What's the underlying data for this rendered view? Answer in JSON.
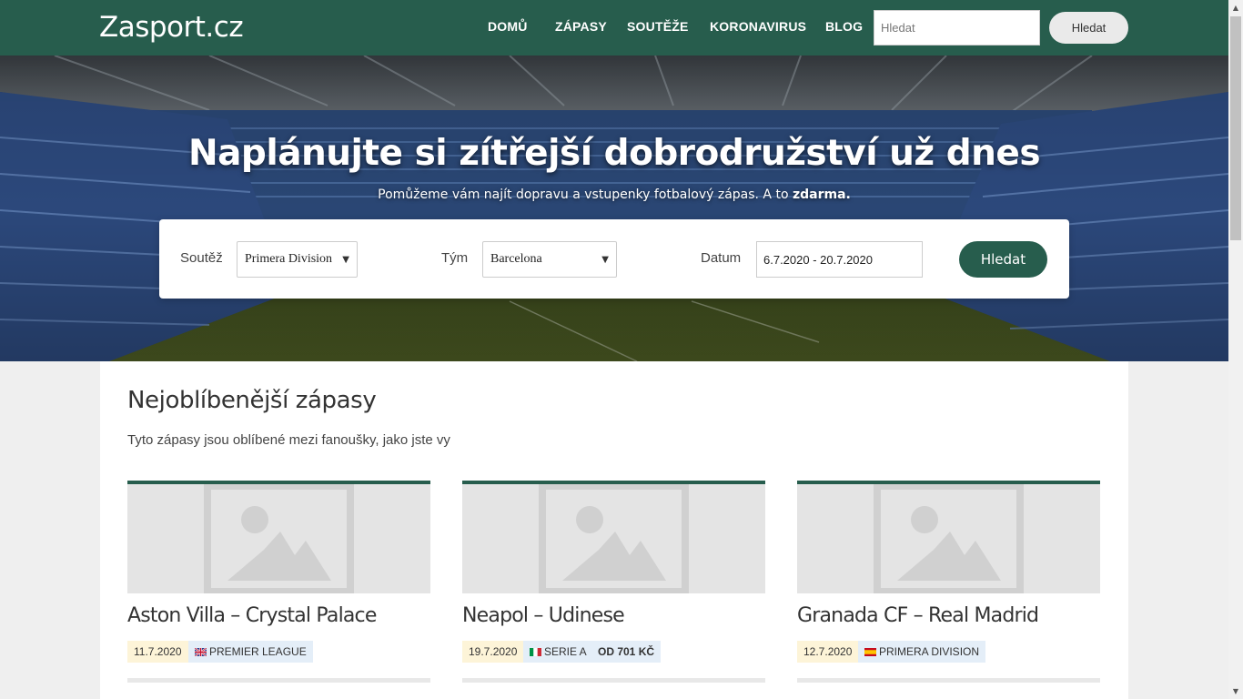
{
  "header": {
    "brand": "Zasport.cz",
    "nav": [
      {
        "label": "DOMŮ"
      },
      {
        "label": "ZÁPASY"
      },
      {
        "label": "SOUTĚŽE"
      },
      {
        "label": "KORONAVIRUS"
      },
      {
        "label": "BLOG"
      }
    ],
    "search_placeholder": "Hledat",
    "search_button": "Hledat"
  },
  "hero": {
    "title": "Naplánujte si zítřejší dobrodružství už dnes",
    "subtitle_prefix": "Pomůžeme vám najít dopravu a vstupenky fotbalový zápas. A to ",
    "subtitle_bold": "zdarma."
  },
  "search_panel": {
    "competition_label": "Soutěž",
    "competition_value": "Primera Division",
    "team_label": "Tým",
    "team_value": "Barcelona",
    "date_label": "Datum",
    "date_value": "6.7.2020 - 20.7.2020",
    "submit": "Hledat"
  },
  "popular": {
    "title": "Nejoblíbenější zápasy",
    "subtitle": "Tyto zápasy jsou oblíbené mezi fanoušky, jako jste vy",
    "matches": [
      {
        "title": "Aston Villa – Crystal Palace",
        "date": "11.7.2020",
        "competition": "PREMIER LEAGUE",
        "flag": "uk"
      },
      {
        "title": "Neapol – Udinese",
        "date": "19.7.2020",
        "competition": "SERIE A",
        "flag": "it",
        "price": "OD 701 KČ"
      },
      {
        "title": "Granada CF – Real Madrid",
        "date": "12.7.2020",
        "competition": "PRIMERA DIVISION",
        "flag": "es"
      }
    ]
  },
  "colors": {
    "brand_green": "#275d4d",
    "date_badge": "#fdf4d8",
    "comp_badge": "#e4eef8"
  }
}
